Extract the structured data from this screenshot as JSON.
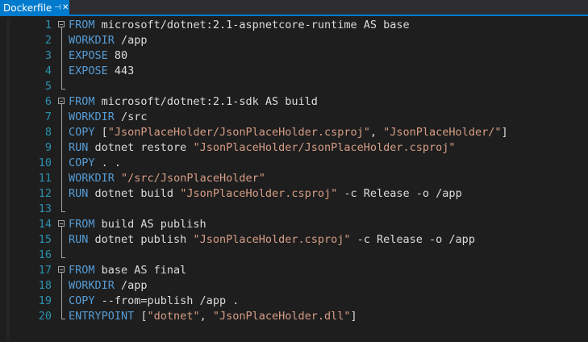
{
  "tab": {
    "title": "Dockerfile",
    "pin_icon": "pin-icon",
    "close_icon": "close-icon"
  },
  "colors": {
    "background": "#1e1e1e",
    "tab_active": "#007acc",
    "keyword": "#569cd6",
    "string": "#d69d85",
    "text": "#dcdcdc",
    "line_number": "#2b91af"
  },
  "lines": [
    {
      "n": "1",
      "fold": "start",
      "tokens": [
        {
          "t": "kw",
          "v": "FROM"
        },
        {
          "t": "tx",
          "v": " microsoft/dotnet:2.1-aspnetcore-runtime AS base"
        }
      ]
    },
    {
      "n": "2",
      "fold": "mid",
      "tokens": [
        {
          "t": "kw",
          "v": "WORKDIR"
        },
        {
          "t": "tx",
          "v": " /app"
        }
      ]
    },
    {
      "n": "3",
      "fold": "mid",
      "tokens": [
        {
          "t": "kw",
          "v": "EXPOSE"
        },
        {
          "t": "tx",
          "v": " 80"
        }
      ]
    },
    {
      "n": "4",
      "fold": "mid",
      "tokens": [
        {
          "t": "kw",
          "v": "EXPOSE"
        },
        {
          "t": "tx",
          "v": " 443"
        }
      ]
    },
    {
      "n": "5",
      "fold": "end",
      "tokens": []
    },
    {
      "n": "6",
      "fold": "start",
      "tokens": [
        {
          "t": "kw",
          "v": "FROM"
        },
        {
          "t": "tx",
          "v": " microsoft/dotnet:2.1-sdk AS build"
        }
      ]
    },
    {
      "n": "7",
      "fold": "mid",
      "tokens": [
        {
          "t": "kw",
          "v": "WORKDIR"
        },
        {
          "t": "tx",
          "v": " /src"
        }
      ]
    },
    {
      "n": "8",
      "fold": "mid",
      "tokens": [
        {
          "t": "kw",
          "v": "COPY"
        },
        {
          "t": "tx",
          "v": " ["
        },
        {
          "t": "st",
          "v": "\"JsonPlaceHolder/JsonPlaceHolder.csproj\""
        },
        {
          "t": "tx",
          "v": ", "
        },
        {
          "t": "st",
          "v": "\"JsonPlaceHolder/\""
        },
        {
          "t": "tx",
          "v": "]"
        }
      ]
    },
    {
      "n": "9",
      "fold": "mid",
      "tokens": [
        {
          "t": "kw",
          "v": "RUN"
        },
        {
          "t": "tx",
          "v": " dotnet restore "
        },
        {
          "t": "st",
          "v": "\"JsonPlaceHolder/JsonPlaceHolder.csproj\""
        }
      ]
    },
    {
      "n": "10",
      "fold": "mid",
      "tokens": [
        {
          "t": "kw",
          "v": "COPY"
        },
        {
          "t": "tx",
          "v": " . ."
        }
      ]
    },
    {
      "n": "11",
      "fold": "mid",
      "tokens": [
        {
          "t": "kw",
          "v": "WORKDIR"
        },
        {
          "t": "tx",
          "v": " "
        },
        {
          "t": "st",
          "v": "\"/src/JsonPlaceHolder\""
        }
      ]
    },
    {
      "n": "12",
      "fold": "mid",
      "tokens": [
        {
          "t": "kw",
          "v": "RUN"
        },
        {
          "t": "tx",
          "v": " dotnet build "
        },
        {
          "t": "st",
          "v": "\"JsonPlaceHolder.csproj\""
        },
        {
          "t": "tx",
          "v": " -c Release -o /app"
        }
      ]
    },
    {
      "n": "13",
      "fold": "end",
      "tokens": []
    },
    {
      "n": "14",
      "fold": "start",
      "tokens": [
        {
          "t": "kw",
          "v": "FROM"
        },
        {
          "t": "tx",
          "v": " build AS publish"
        }
      ]
    },
    {
      "n": "15",
      "fold": "mid",
      "tokens": [
        {
          "t": "kw",
          "v": "RUN"
        },
        {
          "t": "tx",
          "v": " dotnet publish "
        },
        {
          "t": "st",
          "v": "\"JsonPlaceHolder.csproj\""
        },
        {
          "t": "tx",
          "v": " -c Release -o /app"
        }
      ]
    },
    {
      "n": "16",
      "fold": "end",
      "tokens": []
    },
    {
      "n": "17",
      "fold": "start",
      "tokens": [
        {
          "t": "kw",
          "v": "FROM"
        },
        {
          "t": "tx",
          "v": " base AS final"
        }
      ]
    },
    {
      "n": "18",
      "fold": "mid",
      "tokens": [
        {
          "t": "kw",
          "v": "WORKDIR"
        },
        {
          "t": "tx",
          "v": " /app"
        }
      ]
    },
    {
      "n": "19",
      "fold": "mid",
      "tokens": [
        {
          "t": "kw",
          "v": "COPY"
        },
        {
          "t": "tx",
          "v": " --from=publish /app ."
        }
      ]
    },
    {
      "n": "20",
      "fold": "last",
      "tokens": [
        {
          "t": "kw",
          "v": "ENTRYPOINT"
        },
        {
          "t": "tx",
          "v": " ["
        },
        {
          "t": "st",
          "v": "\"dotnet\""
        },
        {
          "t": "tx",
          "v": ", "
        },
        {
          "t": "st",
          "v": "\"JsonPlaceHolder.dll\""
        },
        {
          "t": "tx",
          "v": "]"
        }
      ]
    }
  ]
}
